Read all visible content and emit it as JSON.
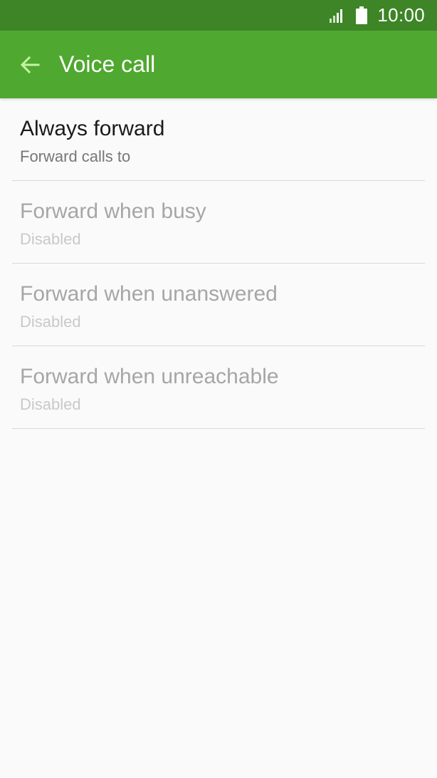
{
  "status_bar": {
    "time": "10:00",
    "icons": [
      "signal-icon",
      "battery-icon"
    ],
    "color": "#3d8526"
  },
  "app_bar": {
    "title": "Voice call",
    "back_icon": "arrow-left-icon",
    "color": "#4fa82f",
    "back_icon_color": "#c6f3a4"
  },
  "list": {
    "items": [
      {
        "title": "Always forward",
        "subtitle": "Forward calls to",
        "enabled": true
      },
      {
        "title": "Forward when busy",
        "subtitle": "Disabled",
        "enabled": false
      },
      {
        "title": "Forward when unanswered",
        "subtitle": "Disabled",
        "enabled": false
      },
      {
        "title": "Forward when unreachable",
        "subtitle": "Disabled",
        "enabled": false
      }
    ]
  }
}
